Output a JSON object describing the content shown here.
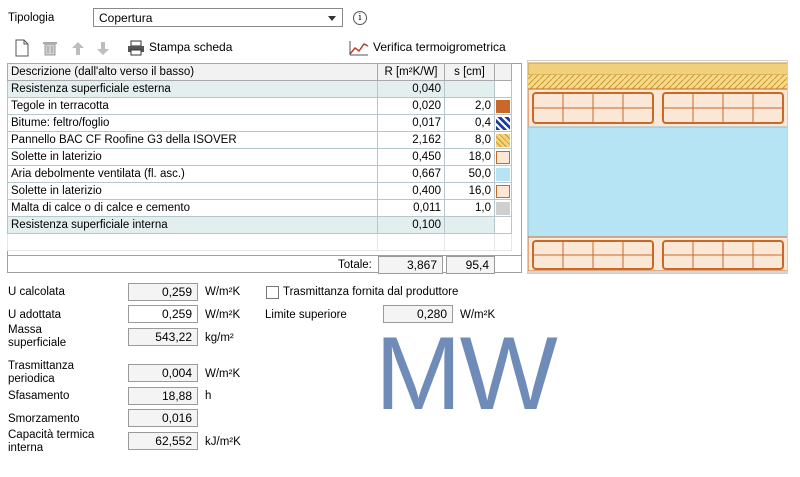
{
  "header": {
    "tipologia_label": "Tipologia",
    "tipologia_value": "Copertura",
    "info_glyph": "i"
  },
  "toolbar": {
    "print_label": "Stampa scheda",
    "verify_label": "Verifica termoigrometrica"
  },
  "table": {
    "headers": [
      "Descrizione (dall'alto verso il basso)",
      "R [m²K/W]",
      "s [cm]"
    ],
    "rows": [
      {
        "desc": "Resistenza superficiale esterna",
        "r": "0,040",
        "s": "",
        "surface": true,
        "swatch": ""
      },
      {
        "desc": "Tegole in terracotta",
        "r": "0,020",
        "s": "2,0",
        "surface": false,
        "swatch": "terracotta"
      },
      {
        "desc": "Bitume: feltro/foglio",
        "r": "0,017",
        "s": "0,4",
        "surface": false,
        "swatch": "bitumen"
      },
      {
        "desc": "Pannello BAC CF Roofine G3 della ISOVER",
        "r": "2,162",
        "s": "8,0",
        "surface": false,
        "swatch": "insulation"
      },
      {
        "desc": "Solette in laterizio",
        "r": "0,450",
        "s": "18,0",
        "surface": false,
        "swatch": "brick"
      },
      {
        "desc": "Aria debolmente ventilata (fl. asc.)",
        "r": "0,667",
        "s": "50,0",
        "surface": false,
        "swatch": "air"
      },
      {
        "desc": "Solette in laterizio",
        "r": "0,400",
        "s": "16,0",
        "surface": false,
        "swatch": "brick"
      },
      {
        "desc": "Malta di calce o di calce e cemento",
        "r": "0,011",
        "s": "1,0",
        "surface": false,
        "swatch": "mortar"
      },
      {
        "desc": "Resistenza superficiale interna",
        "r": "0,100",
        "s": "",
        "surface": true,
        "swatch": ""
      }
    ],
    "total_label": "Totale:",
    "total_r": "3,867",
    "total_s": "95,4"
  },
  "results": {
    "u_calc_label": "U calcolata",
    "u_calc_value": "0,259",
    "u_calc_unit": "W/m²K",
    "u_adopt_label": "U adottata",
    "u_adopt_value": "0,259",
    "u_adopt_unit": "W/m²K",
    "massa_label": "Massa superficiale",
    "massa_value": "543,22",
    "massa_unit": "kg/m²",
    "trasm_label": "Trasmittanza periodica",
    "trasm_value": "0,004",
    "trasm_unit": "W/m²K",
    "sfas_label": "Sfasamento",
    "sfas_value": "18,88",
    "sfas_unit": "h",
    "smorz_label": "Smorzamento",
    "smorz_value": "0,016",
    "cap_label": "Capacità termica interna",
    "cap_value": "62,552",
    "cap_unit": "kJ/m²K",
    "producer_checkbox_label": "Trasmittanza fornita dal produttore",
    "limit_label": "Limite superiore",
    "limit_value": "0,280",
    "limit_unit": "W/m²K"
  },
  "watermark": "MW",
  "colors": {
    "surface_row": "#e3eeef",
    "air": "#b7e4f4",
    "brick": "#f7dcc4",
    "brick_line": "#c8692a",
    "insul": "#f3d27a",
    "watermark": "#6f8bb8"
  },
  "icons": [
    "new-document-icon",
    "delete-icon",
    "arrow-up-icon",
    "arrow-down-icon",
    "printer-icon",
    "chart-icon"
  ]
}
